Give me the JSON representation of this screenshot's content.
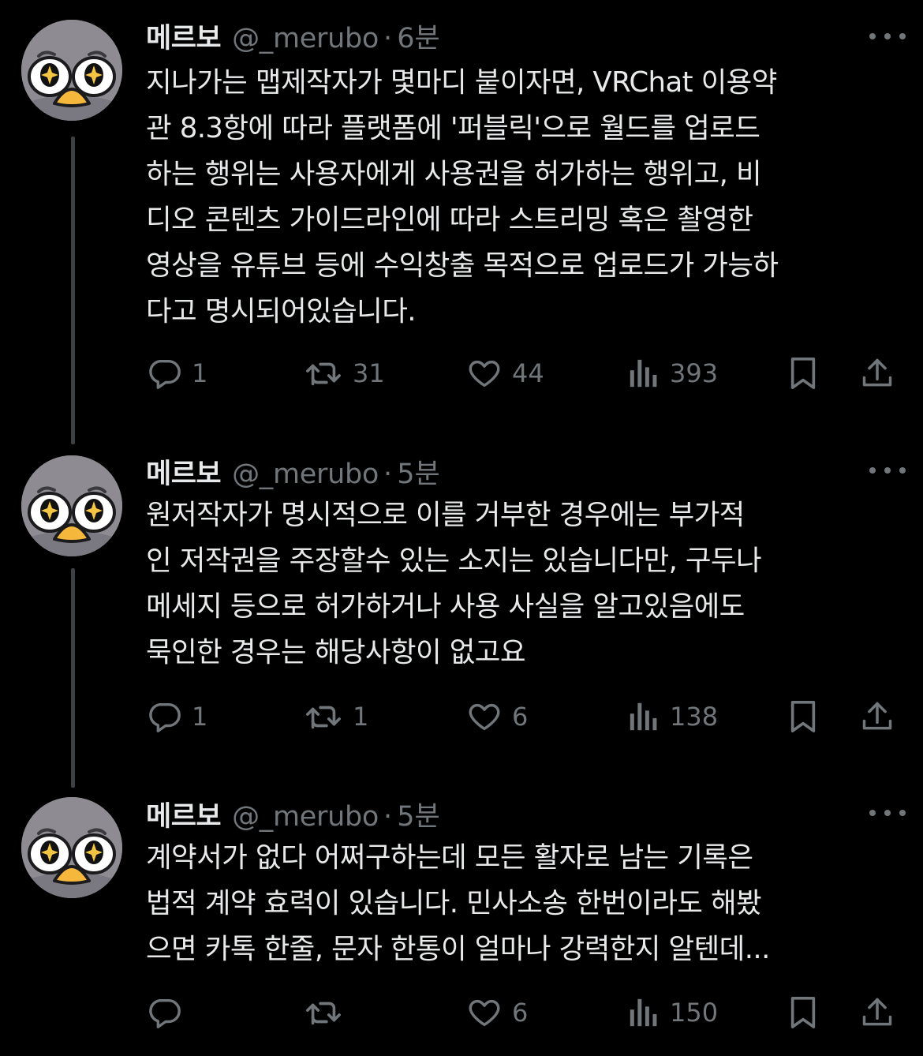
{
  "tweets": [
    {
      "name": "메르보",
      "handle": "@_merubo",
      "separator": "·",
      "time": "6분",
      "lines": [
        "지나가는 맵제작자가 몇마디 붙이자면, VRChat 이용약",
        "관 8.3항에 따라 플랫폼에 '퍼블릭'으로 월드를 업로드",
        "하는 행위는 사용자에게 사용권을 허가하는 행위고, 비",
        "디오 콘텐츠 가이드라인에 따라 스트리밍 혹은 촬영한",
        "영상을 유튜브 등에 수익창출 목적으로 업로드가 가능하",
        "다고 명시되어있습니다."
      ],
      "replies": "1",
      "retweets": "31",
      "likes": "44",
      "views": "393"
    },
    {
      "name": "메르보",
      "handle": "@_merubo",
      "separator": "·",
      "time": "5분",
      "lines": [
        "원저작자가 명시적으로 이를 거부한 경우에는 부가적",
        "인 저작권을 주장할수 있는 소지는 있습니다만, 구두나",
        "메세지 등으로 허가하거나 사용 사실을 알고있음에도",
        "묵인한 경우는 해당사항이 없고요"
      ],
      "replies": "1",
      "retweets": "1",
      "likes": "6",
      "views": "138"
    },
    {
      "name": "메르보",
      "handle": "@_merubo",
      "separator": "·",
      "time": "5분",
      "lines": [
        "계약서가 없다 어쩌구하는데 모든 활자로 남는 기록은",
        "법적 계약 효력이 있습니다. 민사소송 한번이라도 해봤",
        "으면 카톡 한줄, 문자 한통이 얼마나 강력한지 알텐데..."
      ],
      "replies": "",
      "retweets": "",
      "likes": "6",
      "views": "150"
    }
  ],
  "icons": {
    "reply": "reply-icon",
    "retweet": "retweet-icon",
    "like": "heart-icon",
    "views": "views-icon",
    "bookmark": "bookmark-icon",
    "share": "share-icon",
    "more": "more-icon"
  },
  "colors": {
    "background": "#000000",
    "text": "#e7e9ea",
    "secondary": "#71767b",
    "avatar": "#8e8c92",
    "beak": "#f6b83c"
  }
}
